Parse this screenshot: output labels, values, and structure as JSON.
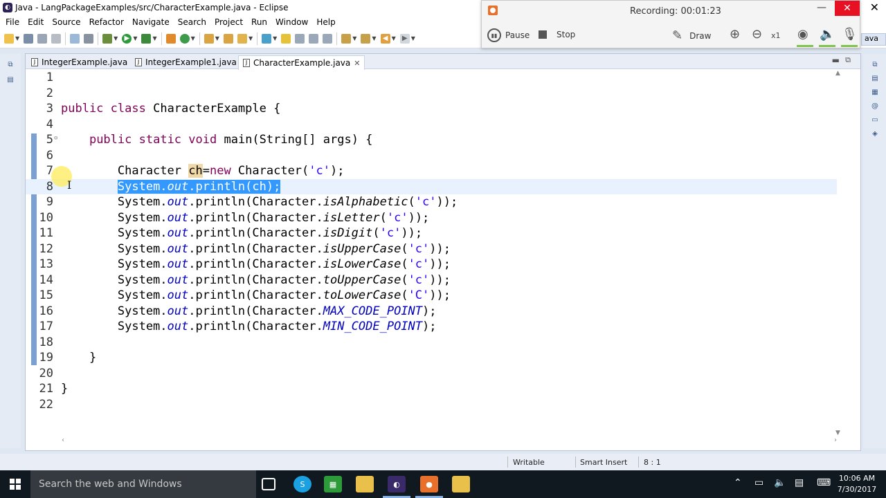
{
  "window": {
    "title": "Java - LangPackageExamples/src/CharacterExample.java - Eclipse",
    "close_glyph": "✕"
  },
  "menu": [
    "File",
    "Edit",
    "Source",
    "Refactor",
    "Navigate",
    "Search",
    "Project",
    "Run",
    "Window",
    "Help"
  ],
  "perspective": {
    "label": "ava"
  },
  "recorder": {
    "status": "Recording:  00:01:23",
    "pause_label": "Pause",
    "stop_label": "Stop",
    "draw_label": "Draw",
    "zoom_label": "x1",
    "minimize_glyph": "—",
    "close_glyph": "✕"
  },
  "editor": {
    "tabs": [
      {
        "label": "IntegerExample.java",
        "active": false
      },
      {
        "label": "IntegerExample1.java",
        "active": false
      },
      {
        "label": "CharacterExample.java",
        "active": true
      }
    ],
    "current_line": 8,
    "lines": [
      "",
      "",
      "public class CharacterExample {",
      "",
      "    public static void main(String[] args) {",
      "",
      "        Character ch=new Character('c');",
      "        System.out.println(ch);",
      "        System.out.println(Character.isAlphabetic('c'));",
      "        System.out.println(Character.isLetter('c'));",
      "        System.out.println(Character.isDigit('c'));",
      "        System.out.println(Character.isUpperCase('c'));",
      "        System.out.println(Character.isLowerCase('c'));",
      "        System.out.println(Character.toUpperCase('c'));",
      "        System.out.println(Character.toLowerCase('C'));",
      "        System.out.println(Character.MAX_CODE_POINT);",
      "        System.out.println(Character.MIN_CODE_POINT);",
      "",
      "    }",
      "",
      "}",
      ""
    ]
  },
  "status": {
    "mode": "Writable",
    "insert": "Smart Insert",
    "position": "8 : 1"
  },
  "taskbar": {
    "search_placeholder": "Search the web and Windows",
    "time": "10:06 AM",
    "date": "7/30/2017"
  }
}
